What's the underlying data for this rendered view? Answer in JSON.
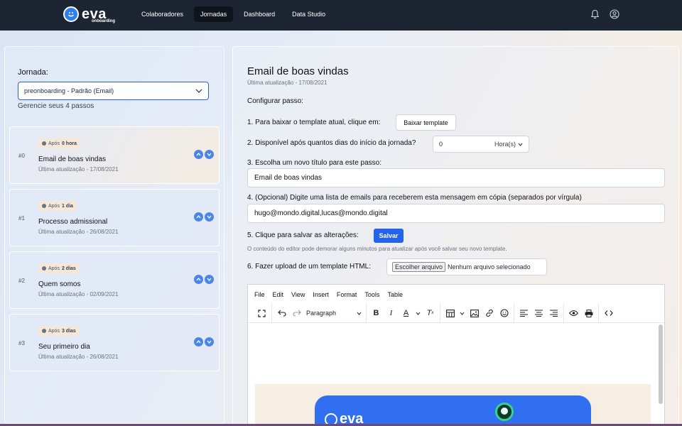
{
  "navbar": {
    "logo_text": "eva",
    "logo_sub": "onboarding",
    "items": [
      {
        "label": "Colaboradores",
        "active": false
      },
      {
        "label": "Jornadas",
        "active": true
      },
      {
        "label": "Dashboard",
        "active": false
      },
      {
        "label": "Data Studio",
        "active": false
      }
    ],
    "icons": [
      "bell-icon",
      "user-icon"
    ]
  },
  "left": {
    "jornada_label": "Jornada:",
    "selected_jornada": "preonboarding - Padrão (Email)",
    "manage_text": "Gerencie seus 4 passos",
    "steps": [
      {
        "num": "#0",
        "badge_prefix": "Após",
        "badge_value": "0 hora",
        "title": "Email de boas vindas",
        "updated": "Última atualização - 17/08/2021"
      },
      {
        "num": "#1",
        "badge_prefix": "Após",
        "badge_value": "1 dia",
        "title": "Processo admissional",
        "updated": "Última atualização - 26/08/2021"
      },
      {
        "num": "#2",
        "badge_prefix": "Após",
        "badge_value": "2 dias",
        "title": "Quem somos",
        "updated": "Última atualização - 02/09/2021"
      },
      {
        "num": "#3",
        "badge_prefix": "Após",
        "badge_value": "3 dias",
        "title": "Seu primeiro dia",
        "updated": "Última atualização - 26/08/2021"
      }
    ]
  },
  "right": {
    "title": "Email de boas vindas",
    "updated": "Última atualização - 17/08/2021",
    "config_label": "Configurar passo:",
    "step1_text": "1. Para baixar o template atual, clique em:",
    "download_button": "Baixar template",
    "step2_text": "2. Disponível após quantos dias do início da jornada?",
    "days_value": "0",
    "days_unit": "Hora(s)",
    "step3_text": "3. Escolha um novo título para este passo:",
    "title_value": "Email de boas vindas",
    "step4_text": "4. (Opcional) Digite uma lista de emails para receberem esta mensagem em cópia (separados por vírgula)",
    "emails_value": "hugo@mondo.digital,lucas@mondo.digital",
    "step5_text": "5. Clique para salvar as alterações:",
    "save_button": "Salvar",
    "note": "O conteúdo do editor pode demorar alguns minutos para atualizar após você salvar seu novo template.",
    "step6_text": "6. Fazer upload de um template HTML:",
    "file_button": "Escolher arquivo",
    "file_status": "Nenhum arquivo selecionado"
  },
  "editor": {
    "menu": [
      "File",
      "Edit",
      "View",
      "Insert",
      "Format",
      "Tools",
      "Table"
    ],
    "paragraph_label": "Paragraph",
    "preview_logo": "eva"
  }
}
